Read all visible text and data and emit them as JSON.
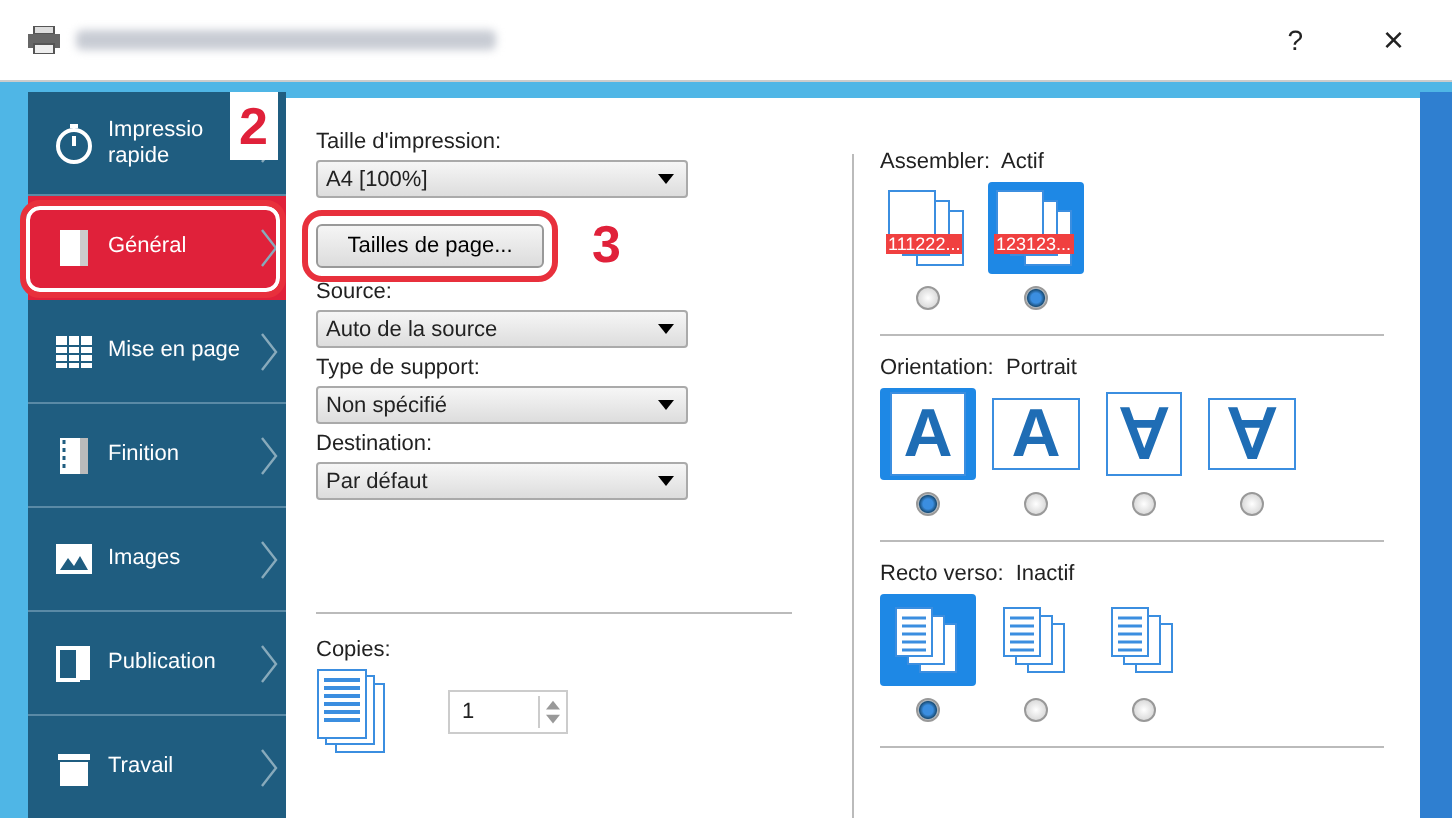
{
  "window": {
    "help": "?",
    "close": "×"
  },
  "sidebar": {
    "items": [
      {
        "label": "Impressio\nrapide",
        "kind": "stopwatch",
        "selected": false
      },
      {
        "label": "Général",
        "kind": "page",
        "selected": true
      },
      {
        "label": "Mise en page",
        "kind": "grid",
        "selected": false
      },
      {
        "label": "Finition",
        "kind": "binder",
        "selected": false
      },
      {
        "label": "Images",
        "kind": "picture",
        "selected": false
      },
      {
        "label": "Publication",
        "kind": "booklet",
        "selected": false
      },
      {
        "label": "Travail",
        "kind": "tray",
        "selected": false
      }
    ]
  },
  "callouts": [
    {
      "number": "2"
    },
    {
      "number": "3"
    }
  ],
  "general": {
    "fields": [
      {
        "label": "Taille d'impression:",
        "value": "A4  [100%]"
      },
      {
        "label": "Source:",
        "value": "Auto de la source"
      },
      {
        "label": "Type de support:",
        "value": "Non spécifié"
      },
      {
        "label": "Destination:",
        "value": "Par défaut"
      }
    ],
    "page_sizes_button": "Tailles de page...",
    "copies": {
      "label": "Copies:",
      "value": "1"
    }
  },
  "options": [
    {
      "label": "Assembler:  Actif",
      "kind": "collate",
      "choices": [
        {
          "text": "111222...",
          "selected": false
        },
        {
          "text": "123123...",
          "selected": true
        }
      ]
    },
    {
      "label": "Orientation:  Portrait",
      "kind": "orientation",
      "choices": [
        {
          "text": "A",
          "selected": true
        },
        {
          "text": "A",
          "selected": false
        },
        {
          "text": "∀",
          "selected": false
        },
        {
          "text": "∀",
          "selected": false
        }
      ]
    },
    {
      "label": "Recto verso:  Inactif",
      "kind": "duplex",
      "choices": [
        {
          "selected": true
        },
        {
          "selected": false
        },
        {
          "selected": false
        }
      ]
    }
  ]
}
